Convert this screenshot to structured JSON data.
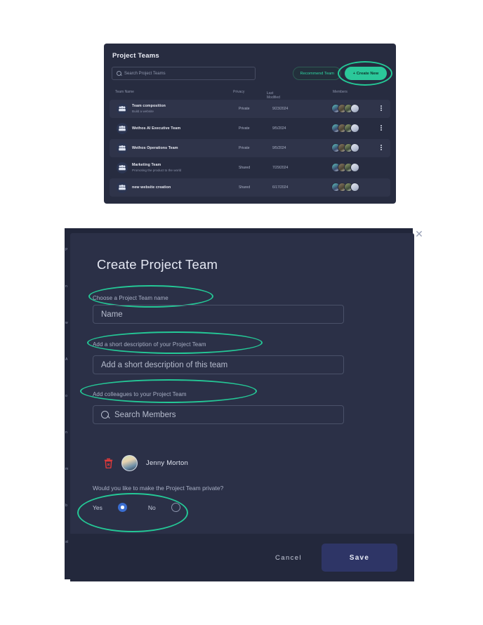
{
  "teams_panel": {
    "title": "Project Teams",
    "search": {
      "placeholder": "Search Project Teams",
      "icon": "search-icon"
    },
    "recommend_button": "Recommend Team",
    "create_button": "+ Create New",
    "columns": {
      "name": "Team Name",
      "privacy": "Privacy",
      "modified": "Last Modified",
      "sort_arrow": "↓",
      "members": "Members"
    },
    "rows": [
      {
        "name": "Team composition",
        "desc": "Build a website",
        "privacy": "Private",
        "modified": "9/23/2024",
        "avatars": 4,
        "menu": true
      },
      {
        "name": "Wethos AI Executive Team",
        "desc": "",
        "privacy": "Private",
        "modified": "9/5/2024",
        "avatars": 4,
        "menu": true
      },
      {
        "name": "Wethos Operations Team",
        "desc": "",
        "privacy": "Private",
        "modified": "9/5/2024",
        "avatars": 4,
        "menu": true
      },
      {
        "name": "Marketing Team",
        "desc": "Promoting the product to the world",
        "privacy": "Shared",
        "modified": "7/29/2024",
        "avatars": 4,
        "menu": false
      },
      {
        "name": "new website creation",
        "desc": "",
        "privacy": "Shared",
        "modified": "6/17/2024",
        "avatars": 4,
        "menu": false
      }
    ]
  },
  "modal": {
    "title": "Create Project Team",
    "close_icon": "close-icon",
    "name_label": "Choose a Project Team name",
    "name_placeholder": "Name",
    "description_label": "Add a short description of your Project Team",
    "description_placeholder": "Add a short description of this team",
    "colleagues_label": "Add colleagues to your Project Team",
    "members_placeholder": "Search Members",
    "member": {
      "name": "Jenny Morton",
      "delete_icon": "trash-icon",
      "avatar": "avatar"
    },
    "privacy_question": "Would you like to make the Project Team private?",
    "radio_yes": "Yes",
    "radio_no": "No",
    "radio_selected": "Yes",
    "cancel_button": "Cancel",
    "save_button": "Save"
  },
  "background_sliver": {
    "fragments": [
      "P",
      "n",
      "w",
      "A",
      "o",
      "n",
      "m",
      "b",
      "st"
    ]
  },
  "colors": {
    "accent_teal": "#24c896",
    "create_button": "#2bc89a",
    "panel_bg": "#272c40",
    "modal_bg": "#2b3047",
    "footer_bg": "#23283c",
    "save_button": "#2e3566",
    "radio_on": "#3a6dd0",
    "delete_icon": "#e03a3a"
  }
}
